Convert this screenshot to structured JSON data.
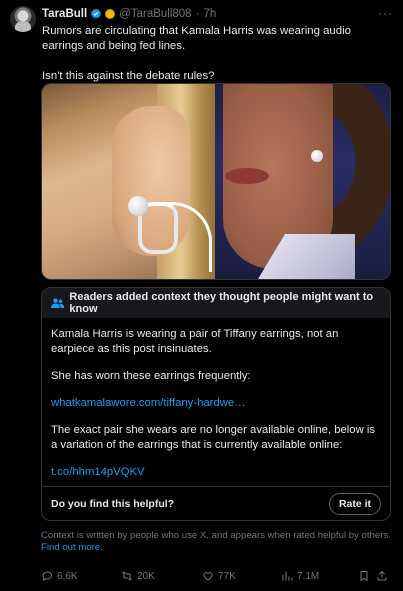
{
  "author": {
    "name": "TaraBull",
    "handle": "@TaraBull808",
    "time": "7h",
    "more": "···"
  },
  "tweet": {
    "line1": "Rumors are circulating that Kamala Harris was wearing audio earrings and being fed lines.",
    "line2": "Isn't this against the debate rules?"
  },
  "community_note": {
    "header": "Readers added context they thought people might want to know",
    "p1": "Kamala Harris is wearing a pair of Tiffany earrings, not an earpiece as this post insinuates.",
    "p2": "She has worn these earrings frequently:",
    "link1": "whatkamalawore.com/tiffany-hardwe…",
    "p3": "The exact pair she wears are no longer available online, below is a variation of the earrings that is currently available online:",
    "link2": "t.co/hhm14pVQKV",
    "helpful_question": "Do you find this helpful?",
    "rate_label": "Rate it"
  },
  "disclaimer": {
    "text": "Context is written by people who use X, and appears when rated helpful by others. ",
    "learn_more": "Find out more."
  },
  "actions": {
    "replies": "6.6K",
    "reposts": "20K",
    "likes": "77K",
    "views": "7.1M"
  },
  "colors": {
    "background": "#000000",
    "text": "#e7e9ea",
    "muted": "#71767b",
    "link": "#1d9bf0",
    "border": "#2f3336",
    "verified": "#1d9bf0"
  },
  "icons": [
    "verified-badge-icon",
    "coin-icon",
    "more-icon",
    "people-icon",
    "reply-icon",
    "repost-icon",
    "like-icon",
    "views-icon",
    "bookmark-icon",
    "share-icon"
  ]
}
